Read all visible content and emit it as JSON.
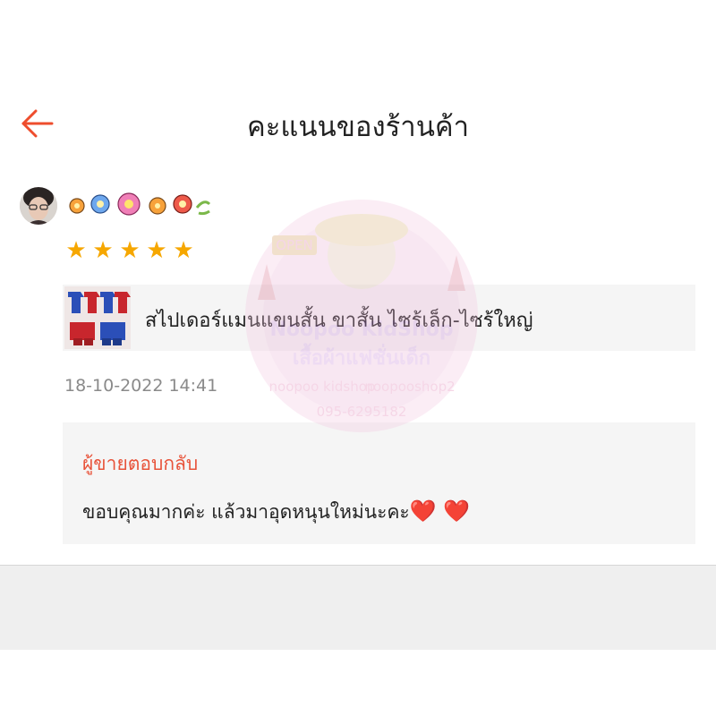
{
  "header": {
    "title": "คะแนนของร้านค้า",
    "back_icon": "arrow-left-icon",
    "accent": "#ee4d2d"
  },
  "review": {
    "rating": 5,
    "star_color": "#f6a700",
    "product_name": "สไปเดอร์แมนแขนสั้น ขาสั้น ไซร้เล็ก-ไซร้ใหญ่",
    "timestamp": "18-10-2022 14:41"
  },
  "seller_reply": {
    "label": "ผู้ขายตอบกลับ",
    "text": "ขอบคุณมากค่ะ แล้วมาอุดหนุนใหม่นะคะ",
    "hearts": "❤️ ❤️"
  },
  "watermark": {
    "sign": "OPEN",
    "line1": "Noopoo KidShop",
    "line2": "เสื้อผ้าแฟชั่นเด็ก",
    "line3": "noopoo kidshop",
    "line4": "noopooshop2",
    "line5": "095-6295182"
  }
}
